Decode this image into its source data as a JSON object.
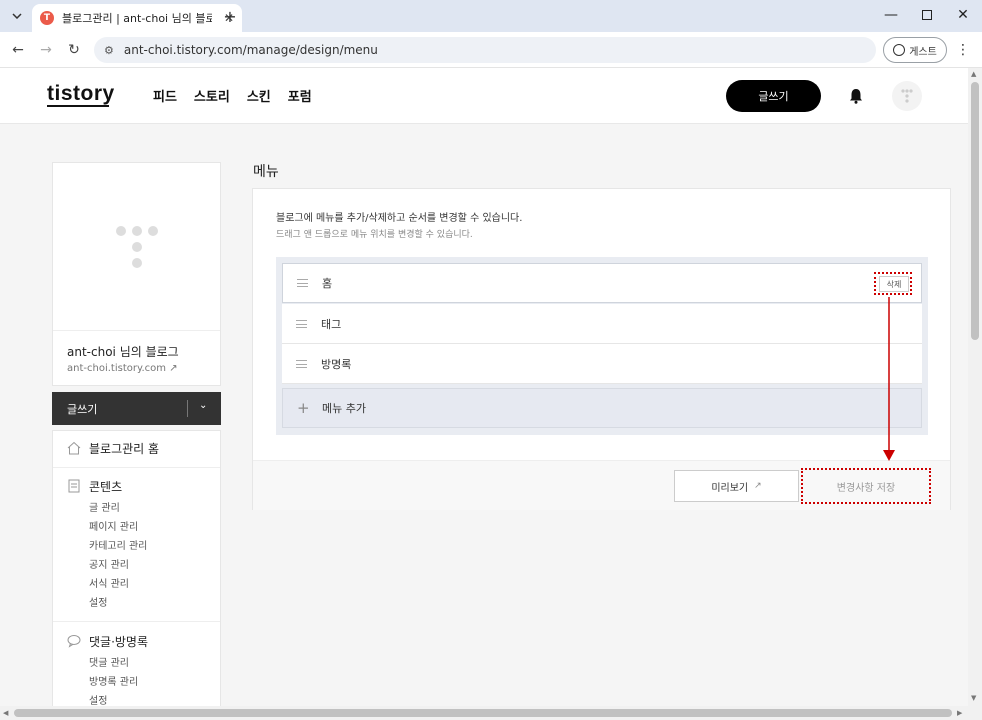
{
  "browser": {
    "tab_title": "블로그관리 | ant-choi 님의 블로그",
    "tab_favicon": "T",
    "url": "ant-choi.tistory.com/manage/design/menu",
    "guest_label": "게스트",
    "icons": [
      "tab-search-icon",
      "close-icon",
      "new-tab-icon",
      "minimize-icon",
      "maximize-icon",
      "window-close-icon",
      "back-icon",
      "forward-icon",
      "reload-icon",
      "site-info-icon",
      "profile-icon",
      "more-icon"
    ]
  },
  "header": {
    "logo": "tistory",
    "nav": [
      "피드",
      "스토리",
      "스킨",
      "포럼"
    ],
    "write_label": "글쓰기"
  },
  "sidebar": {
    "blog_name": "ant-choi 님의 블로그",
    "blog_url": "ant-choi.tistory.com",
    "write_label": "글쓰기",
    "sections": [
      {
        "label": "블로그관리 홈",
        "items": []
      },
      {
        "label": "콘텐츠",
        "items": [
          "글 관리",
          "페이지 관리",
          "카테고리 관리",
          "공지 관리",
          "서식 관리",
          "설정"
        ]
      },
      {
        "label": "댓글·방명록",
        "items": [
          "댓글 관리",
          "방명록 관리",
          "설정"
        ]
      }
    ]
  },
  "main": {
    "title": "메뉴",
    "desc1": "블로그에 메뉴를 추가/삭제하고 순서를 변경할 수 있습니다.",
    "desc2": "드래그 앤 드롭으로 메뉴 위치를 변경할 수 있습니다.",
    "menu_items": [
      "홈",
      "태그",
      "방명록"
    ],
    "delete_label": "삭제",
    "add_label": "메뉴 추가",
    "preview_label": "미리보기",
    "save_label": "변경사항 저장"
  },
  "colors": {
    "annotation_red": "#cc0000",
    "write_button_bg": "#000000",
    "sidebar_write_bg": "#333333"
  }
}
